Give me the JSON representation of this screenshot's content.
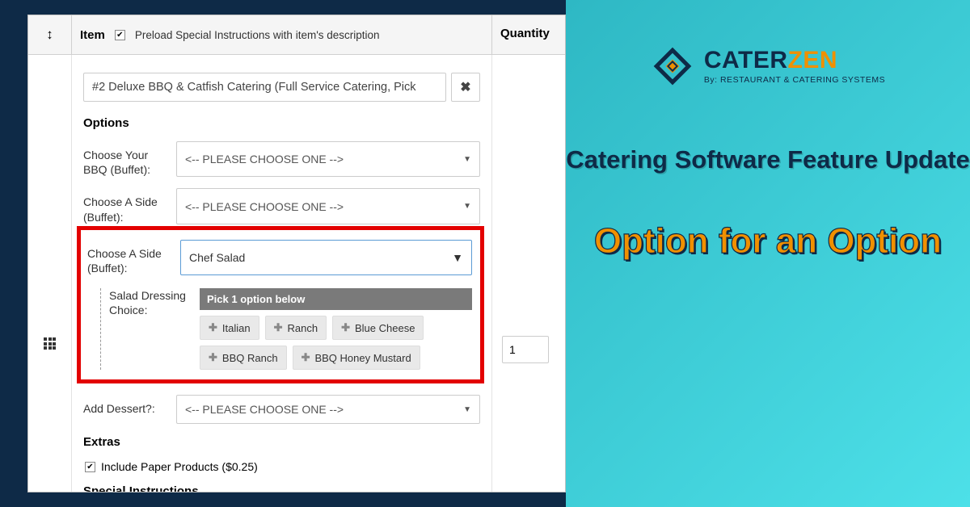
{
  "header": {
    "sort_symbol": "↕",
    "item_label": "Item",
    "preload_checked": true,
    "preload_label": "Preload Special Instructions with item's description",
    "qty_label": "Quantity"
  },
  "item": {
    "name": "#2 Deluxe BBQ & Catfish Catering (Full Service Catering, Pick",
    "close": "✖"
  },
  "options": {
    "heading": "Options",
    "rows": [
      {
        "label": "Choose Your BBQ (Buffet):",
        "value": "<-- PLEASE CHOOSE ONE -->"
      },
      {
        "label": "Choose A Side (Buffet):",
        "value": "<-- PLEASE CHOOSE ONE -->"
      }
    ],
    "highlighted": {
      "label": "Choose A Side (Buffet):",
      "value": "Chef Salad",
      "sub_label": "Salad Dressing Choice:",
      "sub_header": "Pick 1 option below",
      "chips": [
        "Italian",
        "Ranch",
        "Blue Cheese",
        "BBQ Ranch",
        "BBQ Honey Mustard"
      ]
    },
    "dessert": {
      "label": "Add Dessert?:",
      "value": "<-- PLEASE CHOOSE ONE -->"
    }
  },
  "extras": {
    "heading": "Extras",
    "paper_checked": true,
    "paper_label": "Include Paper Products ($0.25)"
  },
  "special": {
    "heading": "Special Instructions"
  },
  "qty_value": "1",
  "logo": {
    "brand1": "CATER",
    "brand2": "ZEN",
    "byline": "By: RESTAURANT & CATERING SYSTEMS"
  },
  "headline1": "Catering Software Feature Update",
  "headline2": "Option for an Option"
}
